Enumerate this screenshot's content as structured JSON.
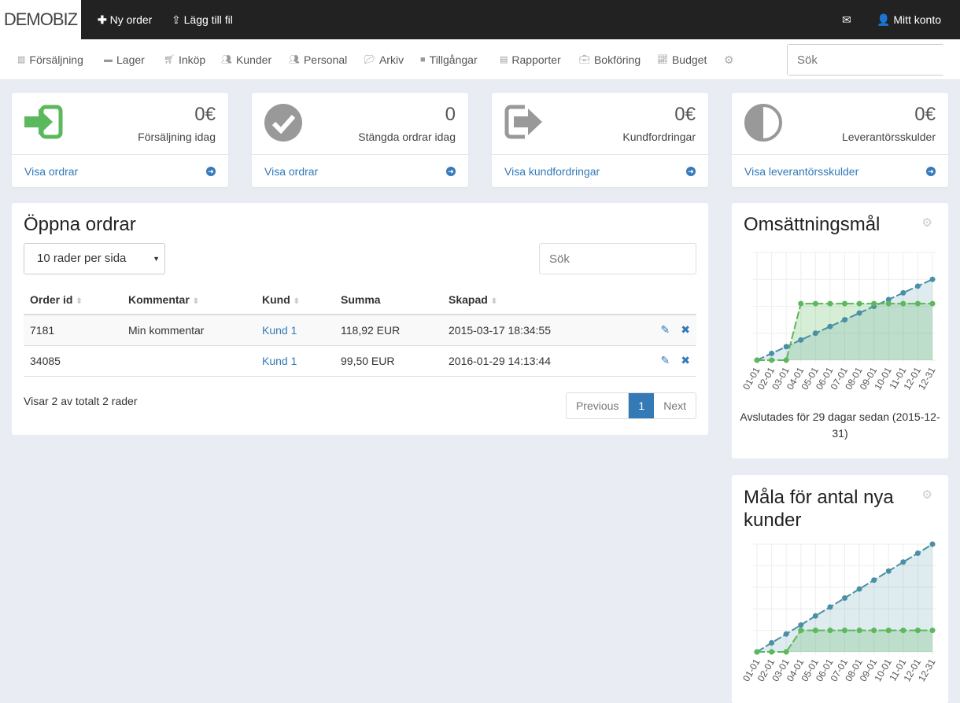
{
  "topbar": {
    "logo": "DEMOBIZ",
    "new_order": "Ny order",
    "add_file": "Lägg till fil",
    "account": "Mitt konto"
  },
  "nav": {
    "items": [
      {
        "label": "Försäljning",
        "icon": "barcode-icon"
      },
      {
        "label": "Lager",
        "icon": "archive-icon"
      },
      {
        "label": "Inköp",
        "icon": "cart-icon"
      },
      {
        "label": "Kunder",
        "icon": "users-icon"
      },
      {
        "label": "Personal",
        "icon": "users-icon"
      },
      {
        "label": "Arkiv",
        "icon": "folder-open-icon"
      },
      {
        "label": "Tillgångar",
        "icon": "folder-icon"
      },
      {
        "label": "Rapporter",
        "icon": "file-icon"
      },
      {
        "label": "Bokföring",
        "icon": "briefcase-icon"
      },
      {
        "label": "Budget",
        "icon": "line-chart-icon"
      }
    ],
    "search_placeholder": "Sök"
  },
  "cards": [
    {
      "value": "0€",
      "label": "Försäljning idag",
      "link": "Visa ordrar",
      "color": "#5cb85c"
    },
    {
      "value": "0",
      "label": "Stängda ordrar idag",
      "link": "Visa ordrar",
      "color": "#999999"
    },
    {
      "value": "0€",
      "label": "Kundfordringar",
      "link": "Visa kundfordringar",
      "color": "#999999"
    },
    {
      "value": "0€",
      "label": "Leverantörsskulder",
      "link": "Visa leverantörsskulder",
      "color": "#999999"
    }
  ],
  "orders": {
    "title": "Öppna ordrar",
    "page_size": "10 rader per sida",
    "search_placeholder": "Sök",
    "columns": [
      "Order id",
      "Kommentar",
      "Kund",
      "Summa",
      "Skapad"
    ],
    "rows": [
      [
        "7181",
        "Min kommentar",
        "Kund 1",
        "118,92 EUR",
        "2015-03-17 18:34:55"
      ],
      [
        "34085",
        "",
        "Kund 1",
        "99,50 EUR",
        "2016-01-29 14:13:44"
      ]
    ],
    "info": "Visar 2 av totalt 2 rader",
    "prev": "Previous",
    "page": "1",
    "next": "Next"
  },
  "widgets": [
    {
      "title": "Omsättningsmål",
      "footer": "Avslutades för 29 dagar sedan (2015-12-31)"
    },
    {
      "title": "Måla för antal nya kunder",
      "footer": ""
    }
  ],
  "chart_data": [
    {
      "type": "line",
      "categories": [
        "01-01",
        "02-01",
        "03-01",
        "04-01",
        "05-01",
        "06-01",
        "07-01",
        "08-01",
        "09-01",
        "10-01",
        "11-01",
        "12-01",
        "12-31"
      ],
      "ylim": [
        0,
        4
      ],
      "grid": true,
      "series": [
        {
          "values": [
            0,
            0.25,
            0.5,
            0.75,
            1,
            1.25,
            1.5,
            1.75,
            2,
            2.25,
            2.5,
            2.75,
            3
          ],
          "color": "#4a90a4"
        },
        {
          "values": [
            0,
            0,
            0,
            2.1,
            2.1,
            2.1,
            2.1,
            2.1,
            2.1,
            2.1,
            2.1,
            2.1,
            2.1
          ],
          "color": "#5cb85c"
        }
      ]
    },
    {
      "type": "line",
      "categories": [
        "01-01",
        "02-01",
        "03-01",
        "04-01",
        "05-01",
        "06-01",
        "07-01",
        "08-01",
        "09-01",
        "10-01",
        "11-01",
        "12-01",
        "12-31"
      ],
      "ylim": [
        0,
        5
      ],
      "grid": true,
      "series": [
        {
          "values": [
            0,
            0.42,
            0.83,
            1.25,
            1.67,
            2.08,
            2.5,
            2.92,
            3.33,
            3.75,
            4.17,
            4.58,
            5
          ],
          "color": "#4a90a4"
        },
        {
          "values": [
            0,
            0,
            0,
            1,
            1,
            1,
            1,
            1,
            1,
            1,
            1,
            1,
            1
          ],
          "color": "#5cb85c"
        }
      ]
    }
  ]
}
